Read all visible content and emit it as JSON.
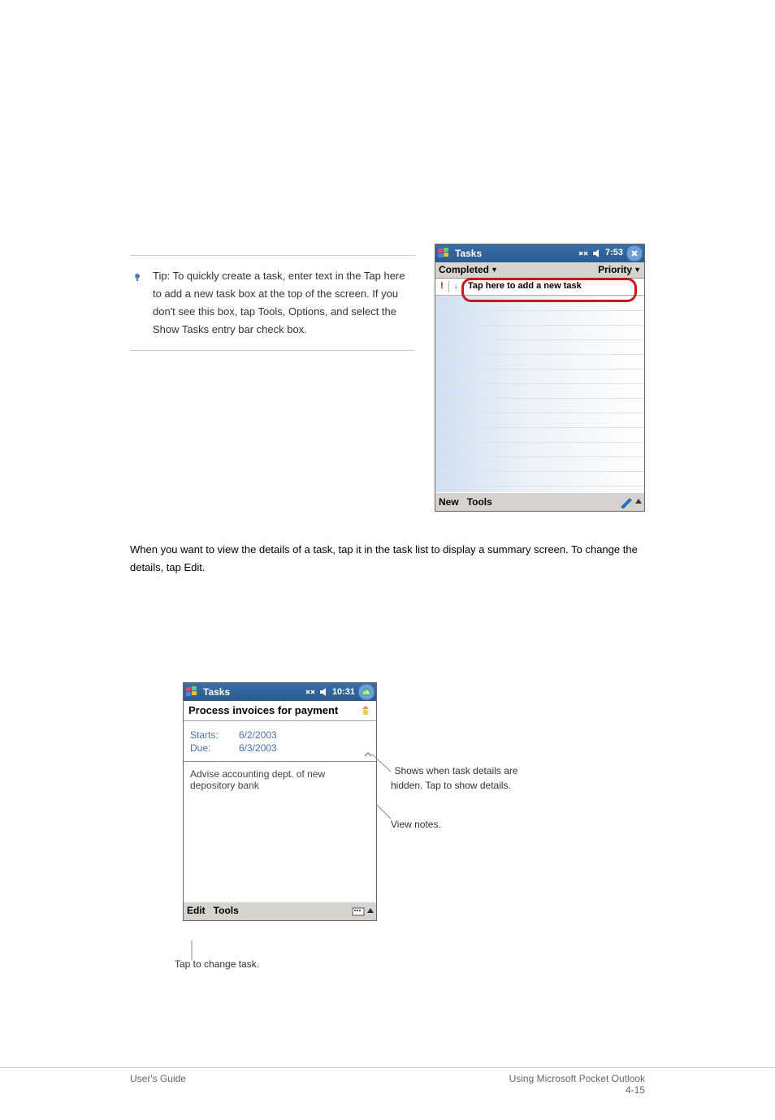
{
  "top_text": {
    "line": "Tip: To quickly create a task, enter text in the Tap here to add a new task box at the top of the screen. If you don't see this box, tap Tools, Options, and select the Show Tasks entry bar check box."
  },
  "shot1": {
    "title": "Tasks",
    "time": "7:53",
    "toolbar_left": "Completed",
    "toolbar_right": "Priority",
    "entry_placeholder": "Tap here to add a new task",
    "bottombar": {
      "new": "New",
      "tools": "Tools"
    }
  },
  "middle_text": "When you want to view the details of a task, tap it in the task list to display a summary screen. To change the details, tap Edit.",
  "shot2": {
    "title": "Tasks",
    "time": "10:31",
    "subject": "Process invoices for payment",
    "starts_label": "Starts:",
    "starts_val": "6/2/2003",
    "due_label": "Due:",
    "due_val": "6/3/2003",
    "note": "Advise accounting dept. of new depository bank",
    "bottombar": {
      "edit": "Edit",
      "tools": "Tools"
    }
  },
  "annotations": {
    "a1": "Shows when task details are hidden. Tap to show details.",
    "a2": "View notes.",
    "a3": "Tap to change task."
  },
  "footer": {
    "left": "User's Guide",
    "right_line1": "Using Microsoft Pocket Outlook",
    "right_line2": "4-15"
  }
}
